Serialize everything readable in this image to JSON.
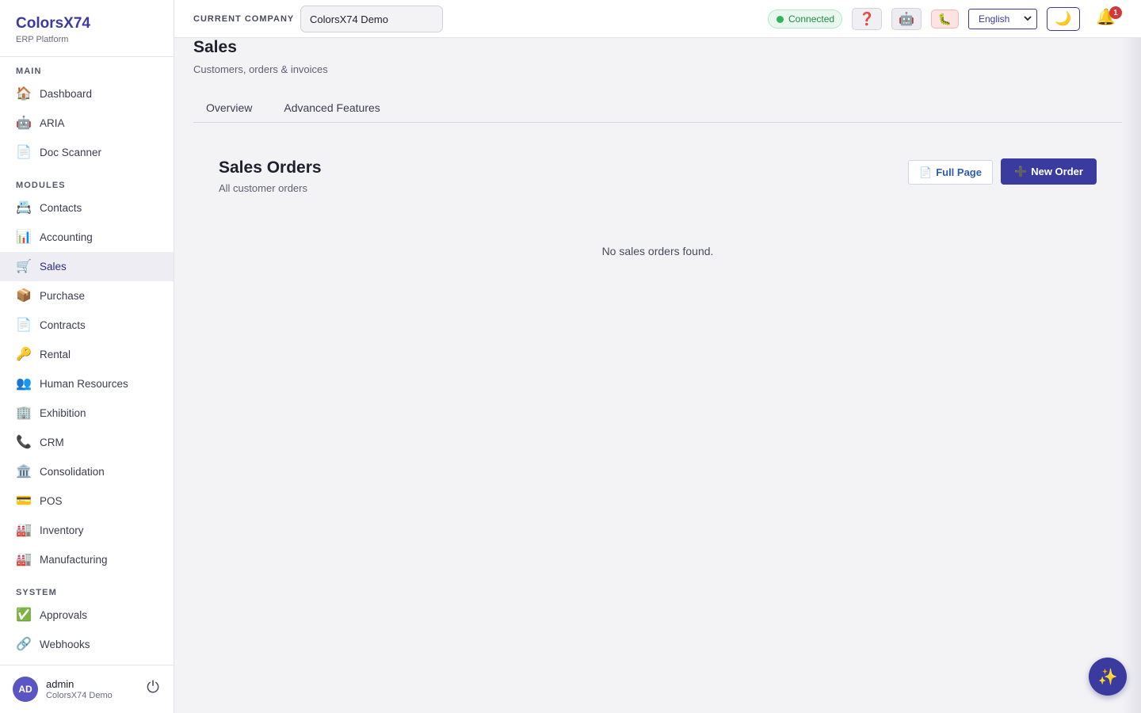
{
  "brand": {
    "name": "ColorsX74",
    "subtitle": "ERP Platform"
  },
  "sidebar": {
    "sections": [
      {
        "label": "MAIN",
        "items": [
          {
            "label": "Dashboard",
            "icon": "home-icon",
            "glyph": "🏠"
          },
          {
            "label": "ARIA",
            "icon": "robot-icon",
            "glyph": "🤖"
          },
          {
            "label": "Doc Scanner",
            "icon": "document-icon",
            "glyph": "📄"
          }
        ]
      },
      {
        "label": "MODULES",
        "items": [
          {
            "label": "Contacts",
            "icon": "card-index-icon",
            "glyph": "📇"
          },
          {
            "label": "Accounting",
            "icon": "bar-chart-icon",
            "glyph": "📊"
          },
          {
            "label": "Sales",
            "icon": "shopping-cart-icon",
            "glyph": "🛒",
            "active": true
          },
          {
            "label": "Purchase",
            "icon": "package-icon",
            "glyph": "📦"
          },
          {
            "label": "Contracts",
            "icon": "document-icon",
            "glyph": "📄"
          },
          {
            "label": "Rental",
            "icon": "key-icon",
            "glyph": "🔑"
          },
          {
            "label": "Human Resources",
            "icon": "people-icon",
            "glyph": "👥"
          },
          {
            "label": "Exhibition",
            "icon": "office-building-icon",
            "glyph": "🏢"
          },
          {
            "label": "CRM",
            "icon": "phone-icon",
            "glyph": "📞"
          },
          {
            "label": "Consolidation",
            "icon": "classical-building-icon",
            "glyph": "🏛️"
          },
          {
            "label": "POS",
            "icon": "credit-card-icon",
            "glyph": "💳"
          },
          {
            "label": "Inventory",
            "icon": "factory-icon",
            "glyph": "🏭"
          },
          {
            "label": "Manufacturing",
            "icon": "factory-icon",
            "glyph": "🏭"
          }
        ]
      },
      {
        "label": "SYSTEM",
        "items": [
          {
            "label": "Approvals",
            "icon": "check-mark-icon",
            "glyph": "✅"
          },
          {
            "label": "Webhooks",
            "icon": "link-icon",
            "glyph": "🔗"
          }
        ]
      }
    ]
  },
  "user": {
    "initials": "AD",
    "name": "admin",
    "company": "ColorsX74 Demo",
    "logout_glyph": "⏻"
  },
  "topbar": {
    "company_label": "CURRENT COMPANY",
    "company_value": "ColorsX74 Demo",
    "status": "Connected",
    "help_glyph": "❓",
    "bot_glyph": "🤖",
    "bug_glyph": "🐛",
    "language": "English",
    "theme_glyph": "🌙",
    "bell_glyph": "🔔",
    "notification_count": "1"
  },
  "page": {
    "title": "Sales",
    "subtitle": "Customers, orders & invoices",
    "tabs": [
      "Overview",
      "Advanced Features"
    ]
  },
  "orders": {
    "title": "Sales Orders",
    "subtitle": "All customer orders",
    "full_page_glyph": "📄",
    "full_page_label": "Full Page",
    "new_order_glyph": "➕",
    "new_order_label": "New Order",
    "empty_message": "No sales orders found."
  },
  "fab_glyph": "✨",
  "colors": {
    "accent": "#3b3a9e",
    "connected": "#2fb35c",
    "badge": "#d63737"
  }
}
